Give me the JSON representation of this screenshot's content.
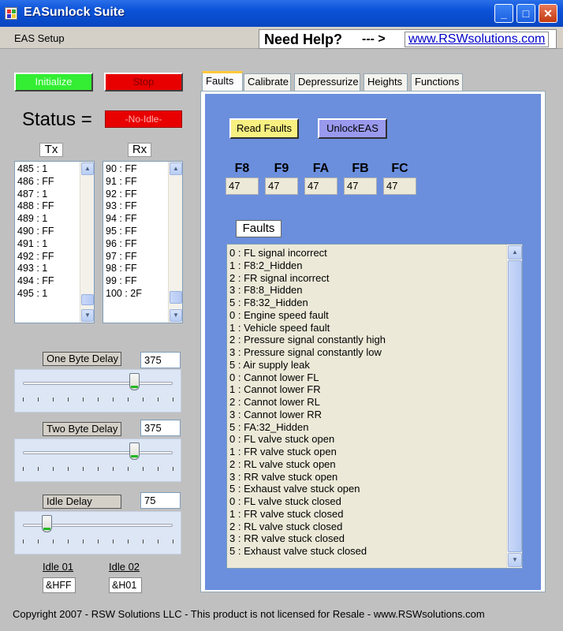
{
  "window": {
    "title": "EASunlock Suite",
    "min": "_",
    "max": "□",
    "close": "✕"
  },
  "menu": {
    "items": [
      "EAS Setup"
    ]
  },
  "help": {
    "text": "Need Help?",
    "arrow": "--- >",
    "link": "www.RSWsolutions.com"
  },
  "controls": {
    "initialize": "Initialize",
    "stop": "Stop",
    "status_label": "Status =",
    "status_value": "-No-Idle-"
  },
  "tx": {
    "header": "Tx",
    "items": [
      "485 : 1",
      "486 : FF",
      "487 : 1",
      "488 : FF",
      "489 : 1",
      "490 : FF",
      "491 : 1",
      "492 : FF",
      "493 : 1",
      "494 : FF",
      "495 : 1"
    ]
  },
  "rx": {
    "header": "Rx",
    "items": [
      "90 : FF",
      "91 : FF",
      "92 : FF",
      "93 : FF",
      "94 : FF",
      "95 : FF",
      "96 : FF",
      "97 : FF",
      "98 : FF",
      "99 : FF",
      "100 : 2F"
    ]
  },
  "delays": {
    "one_byte": {
      "label": "One Byte Delay",
      "value": "375",
      "level": 0.74
    },
    "two_byte": {
      "label": "Two Byte Delay",
      "value": "375",
      "level": 0.74
    },
    "idle": {
      "label": "Idle Delay",
      "value": "75",
      "level": 0.16
    }
  },
  "idle01": {
    "label": "Idle 01",
    "value": "&HFF"
  },
  "idle02": {
    "label": "Idle 02",
    "value": "&H01"
  },
  "tabs": [
    "Faults",
    "Calibrate",
    "Depressurize",
    "Heights",
    "Functions"
  ],
  "faults_tab": {
    "read_faults": "Read Faults",
    "unlock": "UnlockEAS",
    "registers": [
      {
        "name": "F8",
        "value": "47"
      },
      {
        "name": "F9",
        "value": "47"
      },
      {
        "name": "FA",
        "value": "47"
      },
      {
        "name": "FB",
        "value": "47"
      },
      {
        "name": "FC",
        "value": "47"
      }
    ],
    "faults_title": "Faults",
    "faults": [
      "0 : FL signal incorrect",
      "1 : F8:2_Hidden",
      "2 : FR signal incorrect",
      "3 : F8:8_Hidden",
      "5 : F8:32_Hidden",
      "0 : Engine speed fault",
      "1 : Vehicle speed fault",
      "2 : Pressure signal constantly high",
      "3 : Pressure signal constantly low",
      "5 : Air supply leak",
      "0 : Cannot lower FL",
      "1 : Cannot lower FR",
      "2 : Cannot lower RL",
      "3 : Cannot lower RR",
      "5 : FA:32_Hidden",
      "0 : FL valve stuck open",
      "1 : FR valve stuck open",
      "2 : RL valve stuck open",
      "3 : RR valve stuck open",
      "5 : Exhaust valve stuck open",
      "0 : FL valve stuck closed",
      "1 : FR valve stuck closed",
      "2 : RL valve stuck closed",
      "3 : RR valve stuck closed",
      "5 : Exhaust valve stuck closed"
    ]
  },
  "footer": "Copyright 2007 - RSW Solutions LLC - This product is not licensed for Resale - www.RSWsolutions.com"
}
